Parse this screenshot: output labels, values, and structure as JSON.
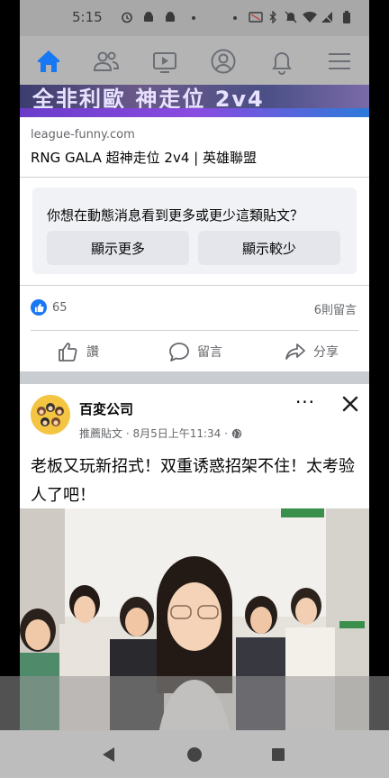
{
  "status_bar": {
    "time": "5:15"
  },
  "nav": {
    "items": [
      {
        "name": "home"
      },
      {
        "name": "friends"
      },
      {
        "name": "watch"
      },
      {
        "name": "profile"
      },
      {
        "name": "notifications"
      },
      {
        "name": "menu"
      }
    ],
    "active_color": "#1877f2",
    "icon_color": "#6b6f75"
  },
  "ad": {
    "image_text": "全非利歐 神走位 2v4"
  },
  "link_post": {
    "domain": "league-funny.com",
    "title": "RNG GALA 超神走位 2v4 | 英雄聯盟",
    "survey": {
      "question": "你想在動態消息看到更多或更少這類貼文？",
      "more_label": "顯示更多",
      "less_label": "顯示較少"
    },
    "reaction_count": "65",
    "comment_count": "6則留言",
    "actions": {
      "like": "讚",
      "comment": "留言",
      "share": "分享"
    }
  },
  "sponsored_post": {
    "page_name": "百変公司",
    "meta": "推薦貼文 · 8月5日上午11:34 ·",
    "more": "···",
    "text": "老板又玩新招式！双重诱惑招架不住！太考验人了吧！"
  }
}
